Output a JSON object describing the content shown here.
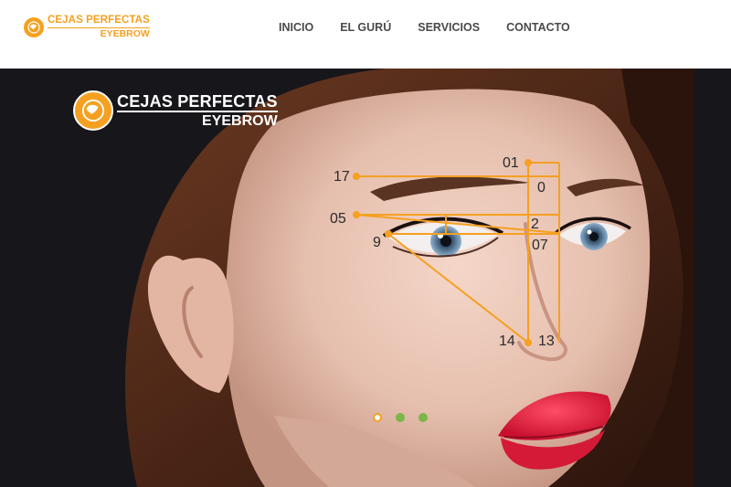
{
  "header": {
    "logo": {
      "line1": "CEJAS PERFECTAS",
      "line2": "EYEBROW",
      "icon": "globe-brow-icon"
    },
    "nav": [
      {
        "label": "INICIO"
      },
      {
        "label": "EL GURÚ"
      },
      {
        "label": "SERVICIOS"
      },
      {
        "label": "CONTACTO"
      }
    ]
  },
  "hero": {
    "logo": {
      "line1": "CEJAS PERFECTAS",
      "line2": "EYEBROW",
      "icon": "globe-brow-icon"
    },
    "measurement_labels": [
      "01",
      "17",
      "0",
      "05",
      "2",
      "9",
      "07",
      "14",
      "13"
    ],
    "carousel": {
      "slide_count": 3,
      "active_index": 0
    }
  },
  "colors": {
    "accent": "#f5a020",
    "nav_text": "#4a4a4a",
    "carousel_idle": "#7ab648",
    "hero_background": "#17161b",
    "lips": "#e11d3c"
  }
}
